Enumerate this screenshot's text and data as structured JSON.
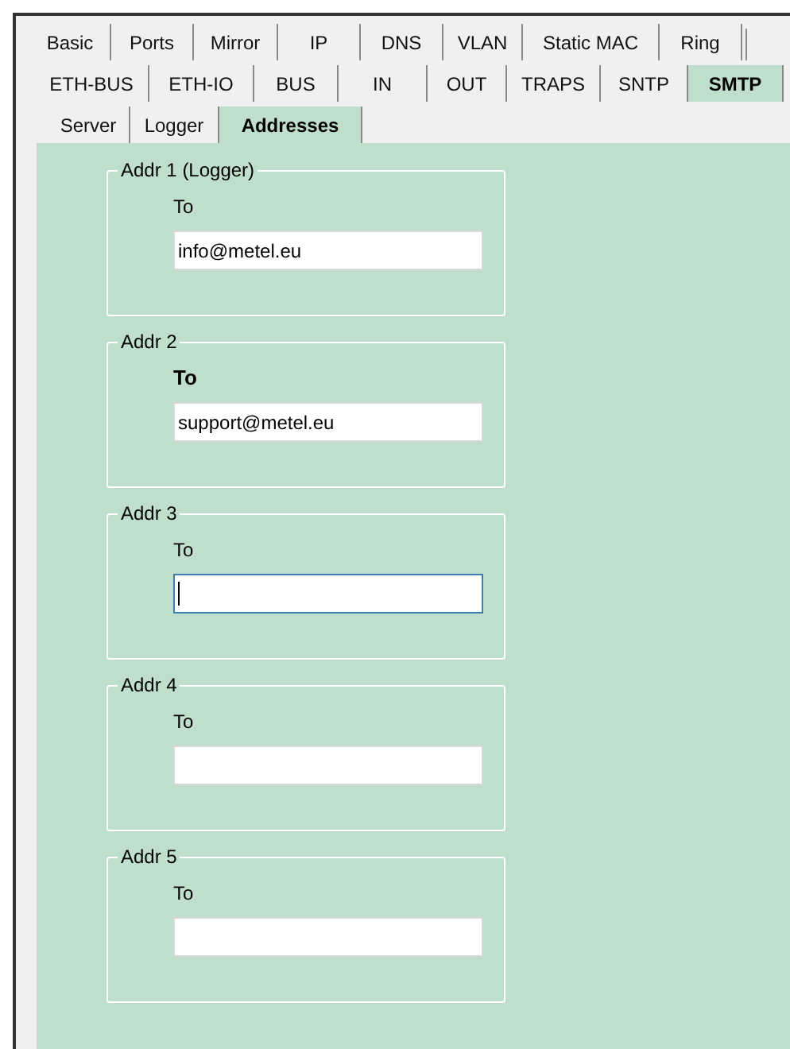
{
  "tab_rows": [
    {
      "tabs": [
        {
          "label": "Basic",
          "selected": false
        },
        {
          "label": "Ports",
          "selected": false
        },
        {
          "label": "Mirror",
          "selected": false
        },
        {
          "label": "IP",
          "selected": false
        },
        {
          "label": "DNS",
          "selected": false
        },
        {
          "label": "VLAN",
          "selected": false
        },
        {
          "label": "Static MAC",
          "selected": false
        },
        {
          "label": "Ring",
          "selected": false
        }
      ]
    },
    {
      "tabs": [
        {
          "label": "ETH-BUS",
          "selected": false
        },
        {
          "label": "ETH-IO",
          "selected": false
        },
        {
          "label": "BUS",
          "selected": false
        },
        {
          "label": "IN",
          "selected": false
        },
        {
          "label": "OUT",
          "selected": false
        },
        {
          "label": "TRAPS",
          "selected": false
        },
        {
          "label": "SNTP",
          "selected": false
        },
        {
          "label": "SMTP",
          "selected": true
        }
      ]
    },
    {
      "tabs": [
        {
          "label": "Server",
          "selected": false
        },
        {
          "label": "Logger",
          "selected": false
        },
        {
          "label": "Addresses",
          "selected": true
        }
      ]
    }
  ],
  "address_groups": [
    {
      "title": "Addr 1 (Logger)",
      "label": "To",
      "label_bold": false,
      "value": "info@metel.eu",
      "focused": false
    },
    {
      "title": "Addr 2",
      "label": "To",
      "label_bold": true,
      "value": "support@metel.eu",
      "focused": false
    },
    {
      "title": "Addr 3",
      "label": "To",
      "label_bold": false,
      "focused": true
    },
    {
      "title": "Addr 4",
      "label": "To",
      "label_bold": false,
      "focused": false
    },
    {
      "title": "Addr 5",
      "label": "To",
      "label_bold": false,
      "focused": false
    }
  ]
}
